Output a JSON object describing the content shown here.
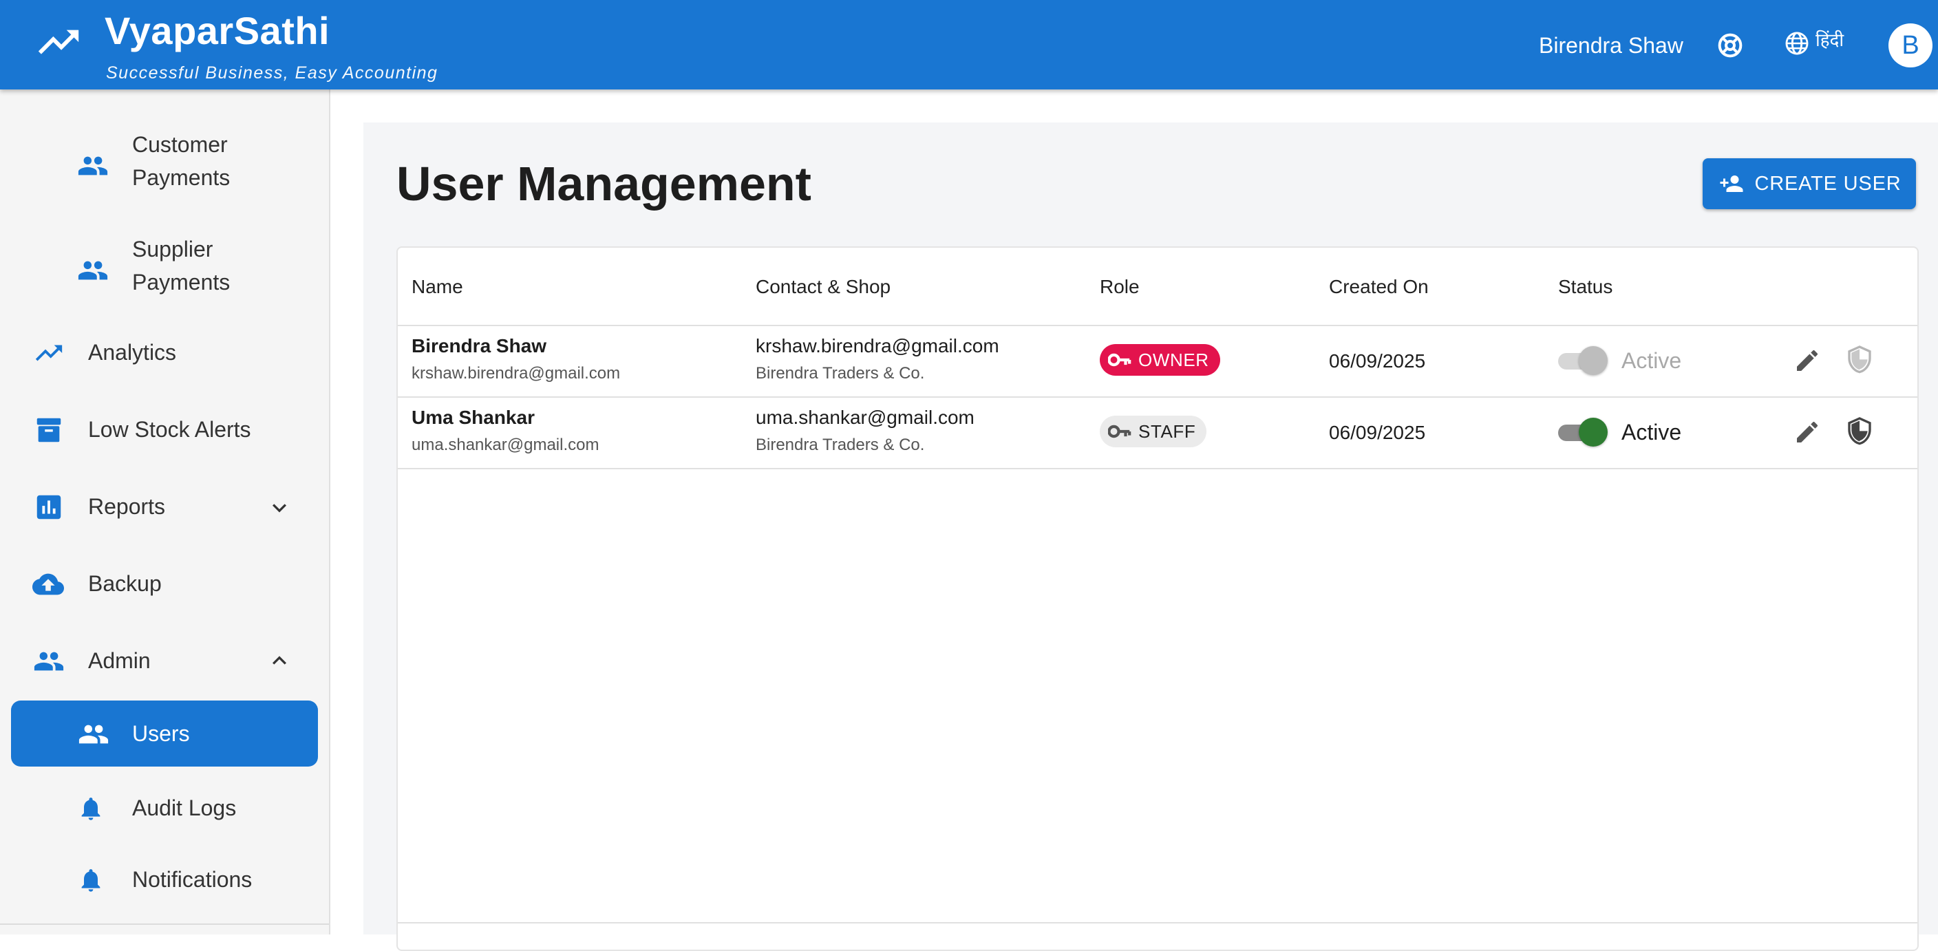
{
  "app": {
    "name": "VyaparSathi",
    "tagline": "Successful Business, Easy Accounting",
    "user_name": "Birendra Shaw",
    "language": "हिंदी",
    "avatar_initial": "B"
  },
  "sidebar": {
    "items": [
      {
        "label_line1": "Customer",
        "label_line2": "Payments",
        "icon": "people-icon"
      },
      {
        "label_line1": "Supplier",
        "label_line2": "Payments",
        "icon": "people-icon"
      },
      {
        "label": "Analytics",
        "icon": "trending-up-icon"
      },
      {
        "label": "Low Stock Alerts",
        "icon": "archive-icon"
      },
      {
        "label": "Reports",
        "icon": "bar-chart-icon",
        "expand": "chevron-down-icon"
      },
      {
        "label": "Backup",
        "icon": "cloud-upload-icon"
      },
      {
        "label": "Admin",
        "icon": "people-icon",
        "expand": "chevron-up-icon"
      },
      {
        "label": "Users",
        "icon": "people-icon",
        "active": true
      },
      {
        "label": "Audit Logs",
        "icon": "bell-icon"
      },
      {
        "label": "Notifications",
        "icon": "bell-icon"
      }
    ]
  },
  "main": {
    "title": "User Management",
    "create_button": "CREATE USER",
    "table": {
      "headers": [
        "Name",
        "Contact & Shop",
        "Role",
        "Created On",
        "Status"
      ],
      "rows": [
        {
          "name": "Birendra Shaw",
          "name_sub": "krshaw.birendra@gmail.com",
          "contact": "krshaw.birendra@gmail.com",
          "shop": "Birendra Traders & Co.",
          "role": "OWNER",
          "created_on": "06/09/2025",
          "status": "Active",
          "status_enabled": false
        },
        {
          "name": "Uma Shankar",
          "name_sub": "uma.shankar@gmail.com",
          "contact": "uma.shankar@gmail.com",
          "shop": "Birendra Traders & Co.",
          "role": "STAFF",
          "created_on": "06/09/2025",
          "status": "Active",
          "status_enabled": true
        }
      ]
    }
  },
  "colors": {
    "primary": "#1976d2",
    "owner_chip": "#e3134d",
    "active_switch": "#2e7d32",
    "sidebar_bg": "#f5f5f5"
  }
}
